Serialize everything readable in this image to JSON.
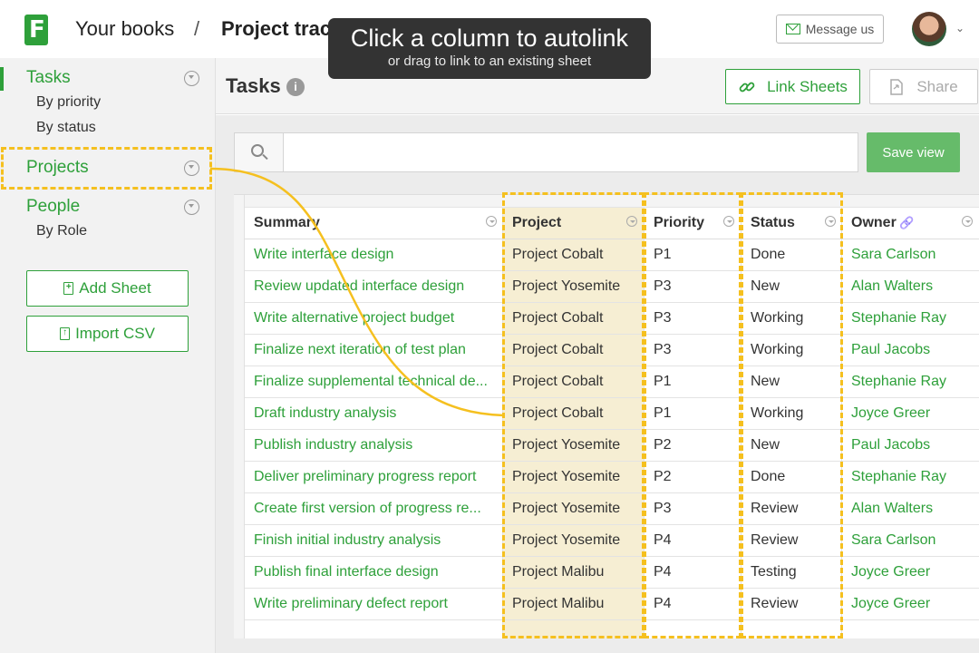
{
  "header": {
    "logo_letter": "F",
    "breadcrumb_books": "Your books",
    "breadcrumb_sep": "/",
    "breadcrumb_project": "Project tracking",
    "message_button": "Message us"
  },
  "tooltip": {
    "title": "Click a column to autolink",
    "subtitle": "or drag to link to an existing sheet"
  },
  "sidebar": {
    "items": [
      {
        "label": "Tasks",
        "subs": [
          "By priority",
          "By status"
        ]
      },
      {
        "label": "Projects",
        "subs": []
      },
      {
        "label": "People",
        "subs": [
          "By Role"
        ]
      }
    ],
    "add_sheet": "Add Sheet",
    "import_csv": "Import CSV"
  },
  "main": {
    "title": "Tasks",
    "info_glyph": "i",
    "link_sheets": "Link Sheets",
    "share": "Share",
    "search_placeholder": "",
    "save_view": "Save view"
  },
  "table": {
    "columns": [
      "Summary",
      "Project",
      "Priority",
      "Status",
      "Owner"
    ],
    "rows": [
      [
        "Write interface design",
        "Project Cobalt",
        "P1",
        "Done",
        "Sara Carlson"
      ],
      [
        "Review updated interface design",
        "Project Yosemite",
        "P3",
        "New",
        "Alan Walters"
      ],
      [
        "Write alternative project budget",
        "Project Cobalt",
        "P3",
        "Working",
        "Stephanie Ray"
      ],
      [
        "Finalize next iteration of test plan",
        "Project Cobalt",
        "P3",
        "Working",
        "Paul Jacobs"
      ],
      [
        "Finalize supplemental technical de...",
        "Project Cobalt",
        "P1",
        "New",
        "Stephanie Ray"
      ],
      [
        "Draft industry analysis",
        "Project Cobalt",
        "P1",
        "Working",
        "Joyce Greer"
      ],
      [
        "Publish industry analysis",
        "Project Yosemite",
        "P2",
        "New",
        "Paul Jacobs"
      ],
      [
        "Deliver preliminary progress report",
        "Project Yosemite",
        "P2",
        "Done",
        "Stephanie Ray"
      ],
      [
        "Create first version of progress re...",
        "Project Yosemite",
        "P3",
        "Review",
        "Alan Walters"
      ],
      [
        "Finish initial industry analysis",
        "Project Yosemite",
        "P4",
        "Review",
        "Sara Carlson"
      ],
      [
        "Publish final interface design",
        "Project Malibu",
        "P4",
        "Testing",
        "Joyce Greer"
      ],
      [
        "Write preliminary defect report",
        "Project Malibu",
        "P4",
        "Review",
        "Joyce Greer"
      ]
    ]
  },
  "colors": {
    "accent": "#2ea03a",
    "highlight": "#f5c01f",
    "project_fill": "#f6eed3"
  }
}
